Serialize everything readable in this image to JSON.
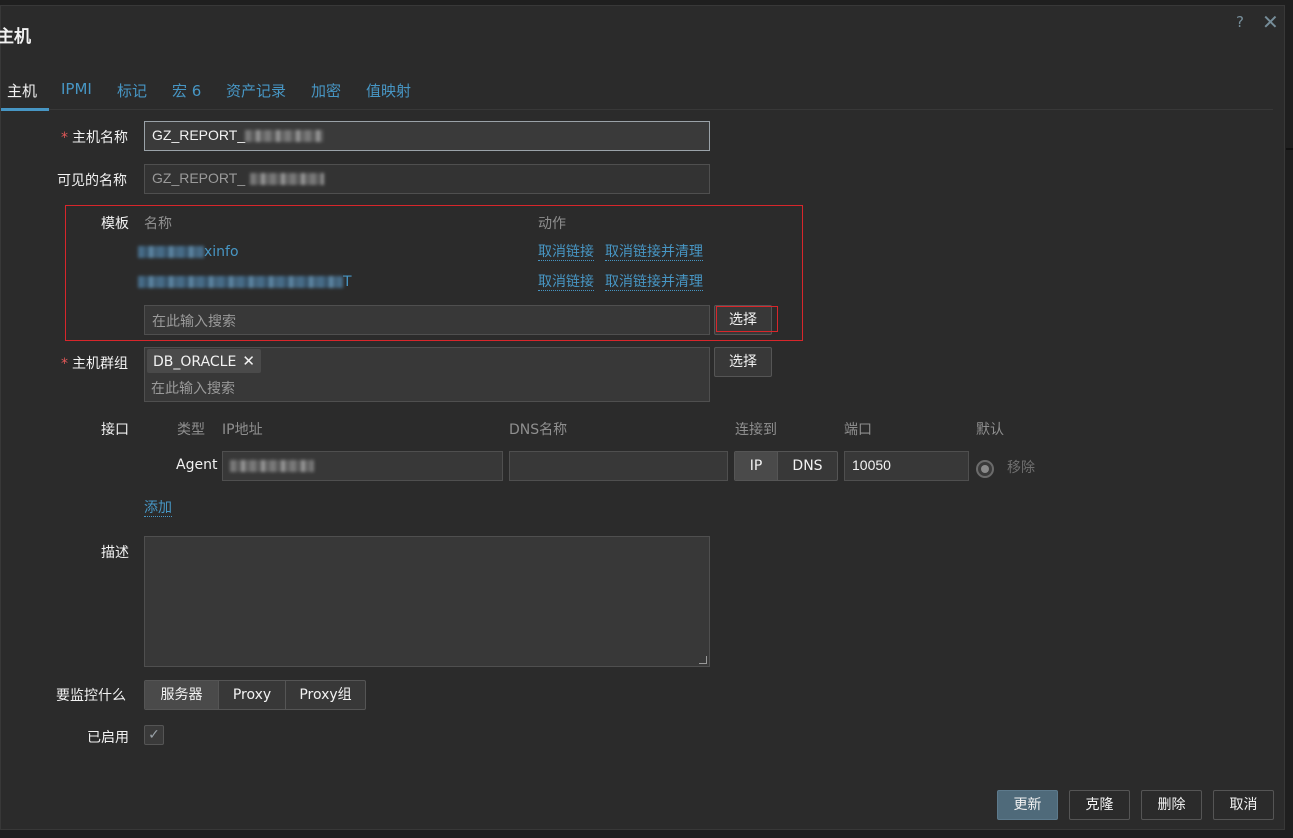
{
  "dialog": {
    "title": "主机",
    "help": "?",
    "close": "✕"
  },
  "tabs": [
    {
      "label": "主机",
      "active": true
    },
    {
      "label": "IPMI"
    },
    {
      "label": "标记"
    },
    {
      "label": "宏 6"
    },
    {
      "label": "资产记录"
    },
    {
      "label": "加密"
    },
    {
      "label": "值映射"
    }
  ],
  "form": {
    "required_mark": "*",
    "host_name_label": "主机名称",
    "host_name_value": "GZ_REPORT_",
    "visible_name_label": "可见的名称",
    "visible_name_value": "GZ_REPORT_",
    "templates": {
      "label": "模板",
      "col_name": "名称",
      "col_action": "动作",
      "rows": [
        {
          "name_suffix": "xinfo",
          "unlink": "取消链接",
          "unlink_clear": "取消链接并清理"
        },
        {
          "name_suffix": "T",
          "unlink": "取消链接",
          "unlink_clear": "取消链接并清理"
        }
      ],
      "search_placeholder": "在此输入搜索",
      "select_button": "选择"
    },
    "host_groups": {
      "label": "主机群组",
      "tag": "DB_ORACLE",
      "tag_remove": "✕",
      "search_placeholder": "在此输入搜索",
      "select_button": "选择"
    },
    "interfaces": {
      "label": "接口",
      "col_type": "类型",
      "col_ip": "IP地址",
      "col_dns": "DNS名称",
      "col_connect": "连接到",
      "col_port": "端口",
      "col_default": "默认",
      "row": {
        "type": "Agent",
        "ip_value": "",
        "dns_value": "",
        "connect_ip": "IP",
        "connect_dns": "DNS",
        "port": "10050",
        "remove": "移除"
      },
      "add": "添加"
    },
    "description_label": "描述",
    "monitored_by": {
      "label": "要监控什么",
      "options": [
        "服务器",
        "Proxy",
        "Proxy组"
      ],
      "selected": "服务器"
    },
    "enabled_label": "已启用",
    "enabled_check": "✓"
  },
  "footer": {
    "update": "更新",
    "clone": "克隆",
    "delete": "删除",
    "cancel": "取消"
  },
  "colors": {
    "accent": "#4796c4",
    "required": "#e45959",
    "highlight": "#d8262b",
    "primary_button": "#4f6a7a"
  }
}
